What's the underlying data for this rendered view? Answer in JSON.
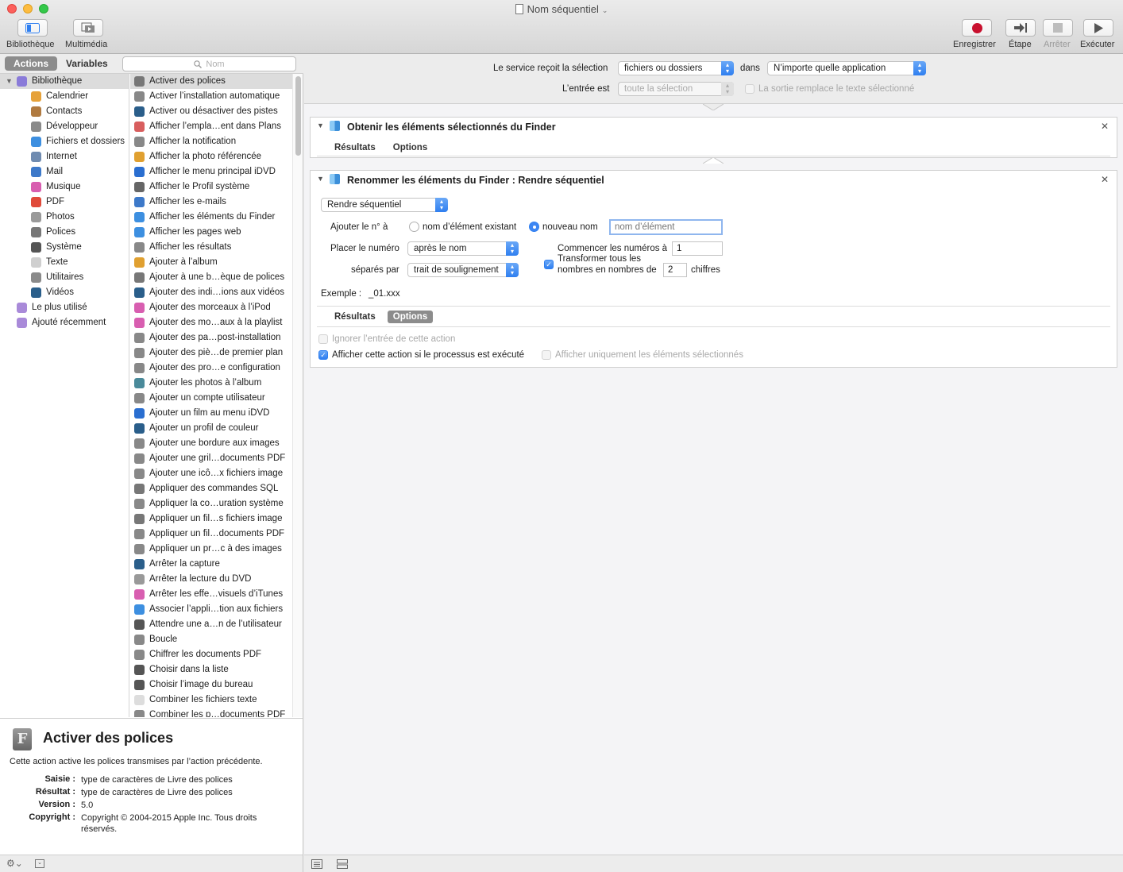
{
  "window": {
    "title": "Nom séquentiel"
  },
  "toolbar": {
    "library": "Bibliothèque",
    "media": "Multimédia",
    "record": "Enregistrer",
    "step": "Étape",
    "stop": "Arrêter",
    "run": "Exécuter"
  },
  "left": {
    "tab_actions": "Actions",
    "tab_variables": "Variables",
    "search_placeholder": "Nom",
    "library": [
      {
        "label": "Bibliothèque",
        "color": "#8a7bd9"
      },
      {
        "label": "Calendrier",
        "color": "#e6a23a"
      },
      {
        "label": "Contacts",
        "color": "#b07a40"
      },
      {
        "label": "Développeur",
        "color": "#8a8a8a"
      },
      {
        "label": "Fichiers et dossiers",
        "color": "#3d8fe0"
      },
      {
        "label": "Internet",
        "color": "#6f8bb0"
      },
      {
        "label": "Mail",
        "color": "#3d79c9"
      },
      {
        "label": "Musique",
        "color": "#d85eb0"
      },
      {
        "label": "PDF",
        "color": "#e04a3a"
      },
      {
        "label": "Photos",
        "color": "#9a9a9a"
      },
      {
        "label": "Polices",
        "color": "#777777"
      },
      {
        "label": "Système",
        "color": "#555555"
      },
      {
        "label": "Texte",
        "color": "#cfcfcf"
      },
      {
        "label": "Utilitaires",
        "color": "#8a8a8a"
      },
      {
        "label": "Vidéos",
        "color": "#2a5e8a"
      },
      {
        "label": "Le plus utilisé",
        "color": "#a98ad9"
      },
      {
        "label": "Ajouté récemment",
        "color": "#a98ad9"
      }
    ],
    "actions": [
      "Activer des polices",
      "Activer l’installation automatique",
      "Activer ou désactiver des pistes",
      "Afficher l’empla…ent dans Plans",
      "Afficher la notification",
      "Afficher la photo référencée",
      "Afficher le menu principal iDVD",
      "Afficher le Profil système",
      "Afficher les e-mails",
      "Afficher les éléments du Finder",
      "Afficher les pages web",
      "Afficher les résultats",
      "Ajouter à l’album",
      "Ajouter à une b…èque de polices",
      "Ajouter des indi…ions aux vidéos",
      "Ajouter des morceaux à l’iPod",
      "Ajouter des mo…aux à la playlist",
      "Ajouter des pa…post-installation",
      "Ajouter des piè…de premier plan",
      "Ajouter des pro…e configuration",
      "Ajouter les photos à l’album",
      "Ajouter un compte utilisateur",
      "Ajouter un film au menu iDVD",
      "Ajouter un profil de couleur",
      "Ajouter une bordure aux images",
      "Ajouter une gril…documents PDF",
      "Ajouter une icô…x fichiers image",
      "Appliquer des commandes SQL",
      "Appliquer la co…uration système",
      "Appliquer un fil…s fichiers image",
      "Appliquer un fil…documents PDF",
      "Appliquer un pr…c à des images",
      "Arrêter la capture",
      "Arrêter la lecture du DVD",
      "Arrêter les effe…visuels d’iTunes",
      "Associer l’appli…tion aux fichiers",
      "Attendre une a…n de l’utilisateur",
      "Boucle",
      "Chiffrer les documents PDF",
      "Choisir dans la liste",
      "Choisir l’image du bureau",
      "Combiner les fichiers texte",
      "Combiner les p…documents PDF"
    ],
    "action_icon_colors": [
      "#777",
      "#888",
      "#2a5e8a",
      "#d85e5e",
      "#888",
      "#e0a030",
      "#2a6ed0",
      "#666",
      "#3d79c9",
      "#3d8fe0",
      "#3d8fe0",
      "#888",
      "#e0a030",
      "#777",
      "#2a5e8a",
      "#d85eb0",
      "#d85eb0",
      "#888",
      "#888",
      "#888",
      "#4a8a9a",
      "#888",
      "#2a6ed0",
      "#2a5e8a",
      "#888",
      "#888",
      "#888",
      "#777",
      "#888",
      "#777",
      "#888",
      "#888",
      "#2a5e8a",
      "#999",
      "#d85eb0",
      "#3d8fe0",
      "#555",
      "#888",
      "#888",
      "#555",
      "#555",
      "#ddd",
      "#888"
    ]
  },
  "description": {
    "title": "Activer des polices",
    "text": "Cette action active les polices transmises par l’action précédente.",
    "rows": [
      {
        "k": "Saisie :",
        "v": "type de caractères de Livre des polices"
      },
      {
        "k": "Résultat :",
        "v": "type de caractères de Livre des polices"
      },
      {
        "k": "Version :",
        "v": "5.0"
      },
      {
        "k": "Copyright :",
        "v": "Copyright © 2004-2015 Apple Inc. Tous droits réservés."
      }
    ]
  },
  "header": {
    "receives_label": "Le service reçoit la sélection",
    "receives_value": "fichiers ou dossiers",
    "in_label": "dans",
    "app_value": "N’importe quelle application",
    "input_label": "L’entrée est",
    "input_value": "toute la sélection",
    "replace_label": "La sortie remplace le texte sélectionné"
  },
  "card1": {
    "title": "Obtenir les éléments sélectionnés du Finder",
    "tab_results": "Résultats",
    "tab_options": "Options"
  },
  "card2": {
    "title": "Renommer les éléments du Finder : Rendre séquentiel",
    "mode": "Rendre séquentiel",
    "add_number_label": "Ajouter le n° à",
    "radio_existing": "nom d’élément existant",
    "radio_new": "nouveau nom",
    "new_name_placeholder": "nom d’élément",
    "place_label": "Placer le numéro",
    "place_value": "après le nom",
    "separator_label": "séparés par",
    "separator_value": "trait de soulignement",
    "start_label": "Commencer les numéros à",
    "start_value": "1",
    "transform_label_1": "Transformer tous les",
    "transform_label_2": "nombres en nombres de",
    "digits_value": "2",
    "digits_suffix": "chiffres",
    "example_label": "Exemple :",
    "example_value": "_01.xxx",
    "tab_results": "Résultats",
    "tab_options": "Options",
    "ignore_input": "Ignorer l’entrée de cette action",
    "show_action": "Afficher cette action si le processus est exécuté",
    "show_selected_only": "Afficher uniquement les éléments sélectionnés"
  }
}
